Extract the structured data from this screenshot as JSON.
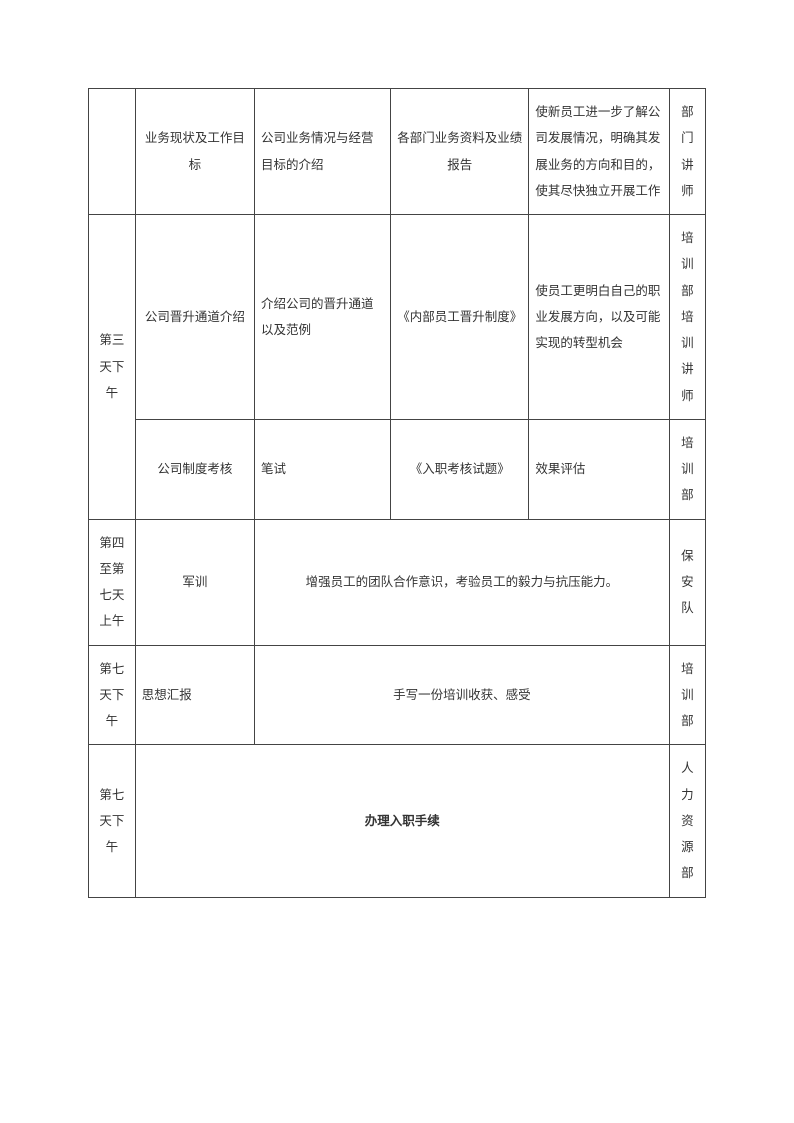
{
  "rows": {
    "r1": {
      "c1": "业务现状及工作目标",
      "c2": "公司业务情况与经营目标的介绍",
      "c3": "各部门业务资料及业绩报告",
      "c4": "使新员工进一步了解公司发展情况，明确其发展业务的方向和目的，使其尽快独立开展工作",
      "c5": "部门讲师"
    },
    "r2": {
      "c0": "第三天下午",
      "c1": "公司晋升通道介绍",
      "c2": "介绍公司的晋升通道以及范例",
      "c3": "《内部员工晋升制度》",
      "c4": "使员工更明白自己的职业发展方向，以及可能实现的转型机会",
      "c5": "培训部培训讲师"
    },
    "r3": {
      "c1": "公司制度考核",
      "c2": "笔试",
      "c3": "《入职考核试题》",
      "c4": "效果评估",
      "c5": "培训部"
    },
    "r4": {
      "c0": "第四至第七天上午",
      "c1": "军训",
      "merged": "增强员工的团队合作意识，考验员工的毅力与抗压能力。",
      "c5": "保安队"
    },
    "r5": {
      "c0": "第七天下午",
      "c1": "思想汇报",
      "merged": "手写一份培训收获、感受",
      "c5": "培训部"
    },
    "r6": {
      "c0": "第七天下午",
      "merged": "办理入职手续",
      "c5": "人力资源部"
    }
  }
}
